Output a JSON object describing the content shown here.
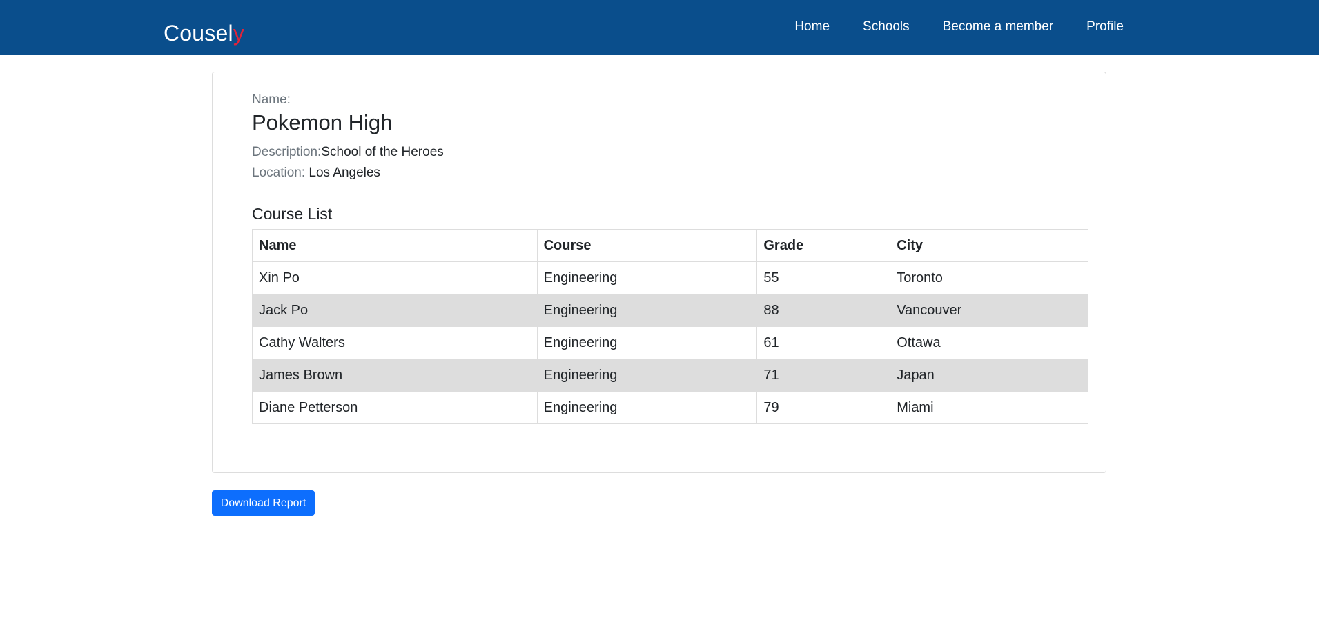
{
  "navbar": {
    "brand_main": "Cousel",
    "brand_accent": "y",
    "links": [
      "Home",
      "Schools",
      "Become a member",
      "Profile"
    ],
    "colors": {
      "background": "#0a4e8c",
      "accent": "#e0243a"
    }
  },
  "school": {
    "name_label": "Name:",
    "name": "Pokemon High",
    "description_label": "Description:",
    "description": "School of the Heroes",
    "location_label": "Location:",
    "location": "Los Angeles"
  },
  "course_list": {
    "heading": "Course List",
    "columns": [
      "Name",
      "Course",
      "Grade",
      "City"
    ],
    "rows": [
      [
        "Xin Po",
        "Engineering",
        "55",
        "Toronto"
      ],
      [
        "Jack Po",
        "Engineering",
        "88",
        "Vancouver"
      ],
      [
        "Cathy Walters",
        "Engineering",
        "61",
        "Ottawa"
      ],
      [
        "James Brown",
        "Engineering",
        "71",
        "Japan"
      ],
      [
        "Diane Petterson",
        "Engineering",
        "79",
        "Miami"
      ]
    ]
  },
  "actions": {
    "download_label": "Download Report",
    "button_color": "#0d6efd"
  }
}
